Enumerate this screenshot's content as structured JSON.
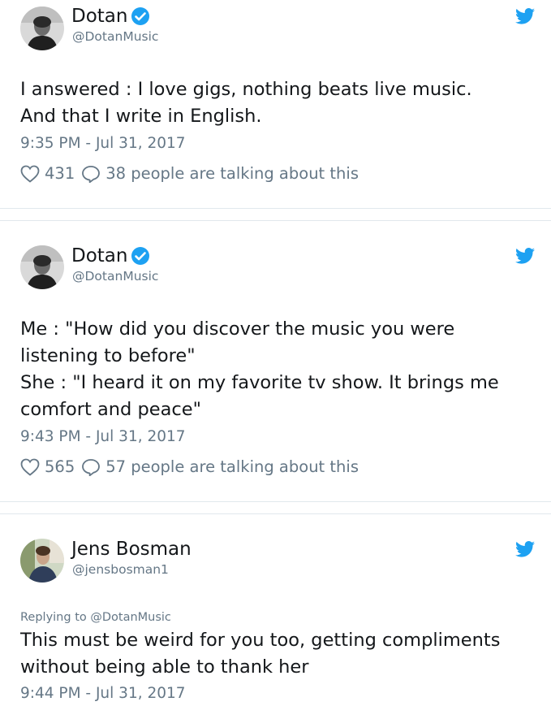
{
  "tweets": [
    {
      "name": "Dotan",
      "handle": "@DotanMusic",
      "text": "I answered : I love gigs, nothing beats live music.\nAnd that I write in English.",
      "time": "9:35 PM - Jul 31, 2017",
      "likes": "431",
      "talking": "38 people are talking about this"
    },
    {
      "name": "Dotan",
      "handle": "@DotanMusic",
      "text": "Me : \"How did you discover the music you were\nlistening to before\"\nShe : \"I heard it on my favorite tv show. It brings me\ncomfort and peace\"",
      "time": "9:43 PM - Jul 31, 2017",
      "likes": "565",
      "talking": "57 people are talking about this"
    },
    {
      "name": "Jens Bosman",
      "handle": "@jensbosman1",
      "replying": "Replying to @DotanMusic",
      "text": "This must be weird for you too, getting compliments\nwithout being able to thank her",
      "time": "9:44 PM - Jul 31, 2017"
    }
  ],
  "colors": {
    "twitter_blue": "#1da1f2",
    "secondary_text": "#657786",
    "divider": "#e1e8ed"
  }
}
